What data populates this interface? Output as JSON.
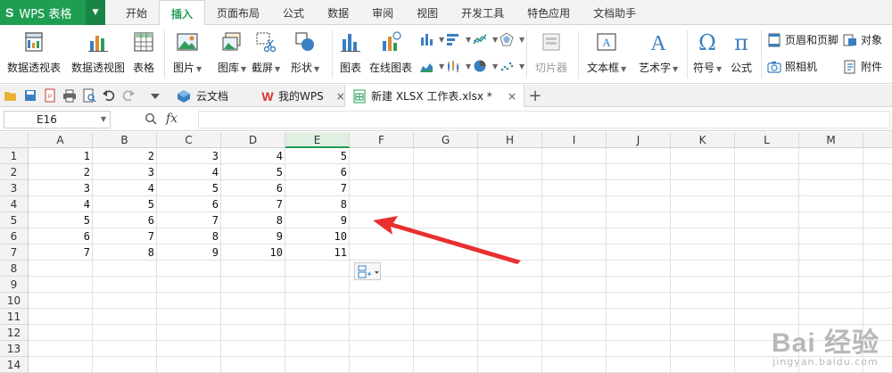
{
  "app": {
    "logo": "S",
    "name": "WPS 表格"
  },
  "menu_tabs": [
    "开始",
    "插入",
    "页面布局",
    "公式",
    "数据",
    "审阅",
    "视图",
    "开发工具",
    "特色应用",
    "文档助手"
  ],
  "active_menu_tab": "插入",
  "ribbon": {
    "pivot_table": "数据透视表",
    "pivot_chart": "数据透视图",
    "table": "表格",
    "picture": "图片",
    "gallery": "图库",
    "screenshot": "截屏",
    "shapes": "形状",
    "chart": "图表",
    "online_chart": "在线图表",
    "slicer": "切片器",
    "textbox": "文本框",
    "wordart": "艺术字",
    "symbol": "符号",
    "formula": "公式",
    "symbol_glyph": "Ω",
    "formula_glyph": "π",
    "wordart_glyph": "A",
    "header_footer": "页眉和页脚",
    "object": "对象",
    "camera": "照相机",
    "attachment": "附件"
  },
  "doc_tabs": [
    {
      "label": "云文档"
    },
    {
      "label": "我的WPS"
    },
    {
      "label": "新建 XLSX 工作表.xlsx *"
    }
  ],
  "tab_close": "×",
  "new_tab": "+",
  "formula_bar": {
    "cell_ref": "E16",
    "fx": "fx",
    "value": ""
  },
  "columns": [
    "A",
    "B",
    "C",
    "D",
    "E",
    "F",
    "G",
    "H",
    "I",
    "J",
    "K",
    "L",
    "M",
    "N"
  ],
  "selected_column": "E",
  "rows": [
    "1",
    "2",
    "3",
    "4",
    "5",
    "6",
    "7",
    "8",
    "9",
    "10",
    "11",
    "12",
    "13",
    "14"
  ],
  "cells": [
    [
      "1",
      "2",
      "3",
      "4",
      "5"
    ],
    [
      "2",
      "3",
      "4",
      "5",
      "6"
    ],
    [
      "3",
      "4",
      "5",
      "6",
      "7"
    ],
    [
      "4",
      "5",
      "6",
      "7",
      "8"
    ],
    [
      "5",
      "6",
      "7",
      "8",
      "9"
    ],
    [
      "6",
      "7",
      "8",
      "9",
      "10"
    ],
    [
      "7",
      "8",
      "9",
      "10",
      "11"
    ]
  ],
  "colors": {
    "brand": "#1f9e52",
    "arrow": "#e8302f"
  },
  "watermark": {
    "main": "Bai 经验",
    "sub": "jingyan.baidu.com"
  }
}
